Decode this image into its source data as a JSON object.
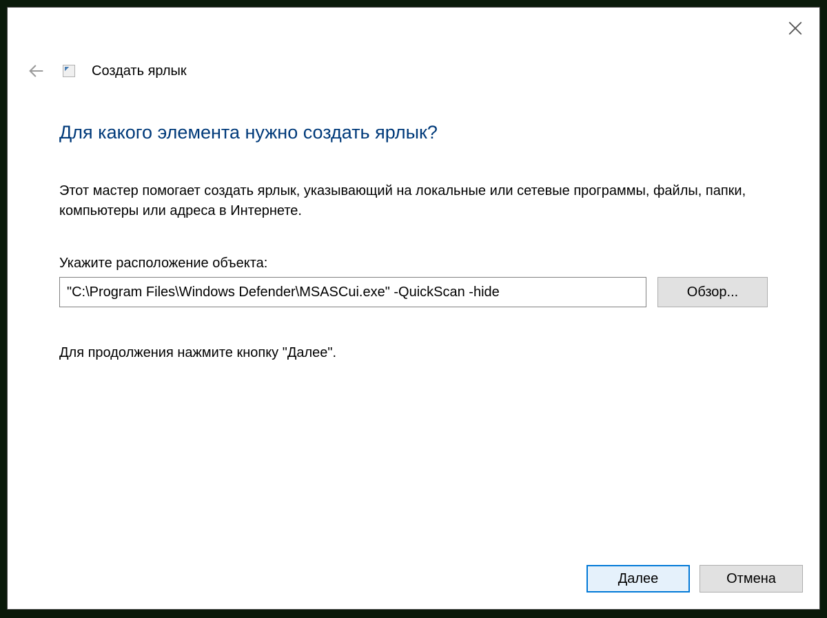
{
  "window": {
    "title": "Создать ярлык"
  },
  "wizard": {
    "heading": "Для какого элемента нужно создать ярлык?",
    "description": "Этот мастер помогает создать ярлык, указывающий на локальные или сетевые программы, файлы, папки, компьютеры или адреса в Интернете.",
    "field_label": "Укажите расположение объекта:",
    "location_value": "\"C:\\Program Files\\Windows Defender\\MSASCui.exe\" -QuickScan -hide",
    "browse_label": "Обзор...",
    "continue_text": "Для продолжения нажмите кнопку \"Далее\"."
  },
  "footer": {
    "next_label": "Далее",
    "cancel_label": "Отмена"
  }
}
